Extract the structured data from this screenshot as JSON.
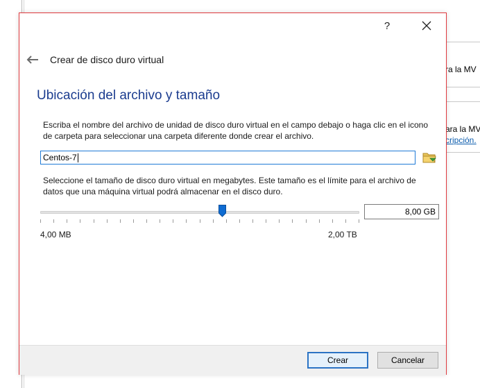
{
  "background_window": {
    "panel1_text": "ra la MV",
    "panel2_text": "ara la MV",
    "panel2_link": "cripción."
  },
  "dialog": {
    "help_label": "?",
    "close_label": "✕",
    "back_icon": "←",
    "wizard_title": "Crear de disco duro virtual",
    "section_title": "Ubicación del archivo y tamaño",
    "file_description": "Escriba el nombre del archivo de unidad de disco duro virtual en el campo debajo o haga clic en el icono de carpeta para seleccionar una carpeta diferente donde crear el archivo.",
    "file_name_value": "Centos-7",
    "size_description": "Seleccione el tamaño de disco duro virtual en megabytes. Este tamaño es el límite para el archivo de datos que una máquina virtual podrá almacenar en el disco duro.",
    "slider": {
      "min_label": "4,00 MB",
      "max_label": "2,00 TB",
      "value_fraction": 0.57,
      "tick_count": 24
    },
    "size_value": "8,00 GB",
    "buttons": {
      "create_label": "Crear",
      "cancel_label": "Cancelar"
    },
    "colors": {
      "title_blue": "#1b3c8f",
      "accent_blue": "#1e7ad6",
      "border_red": "#e0393e"
    }
  }
}
